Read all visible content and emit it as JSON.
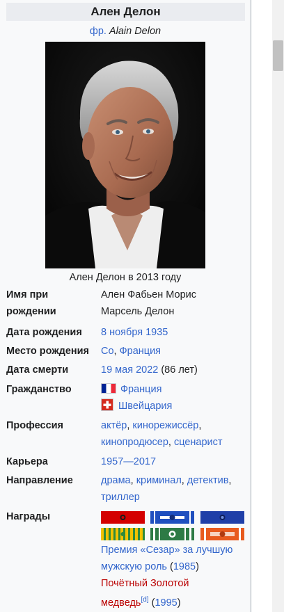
{
  "infobox": {
    "title": "Ален Делон",
    "original_lang": "фр.",
    "original_name": "Alain Delon",
    "caption": "Ален Делон в 2013 году",
    "birth_name_label_1": "Имя при",
    "birth_name_label_2": "рождении",
    "birth_name_value_1": "Ален Фабьен Морис",
    "birth_name_value_2": "Марсель Делон",
    "birth_date_label": "Дата рождения",
    "birth_date_value": "8 ноября 1935",
    "birth_place_label": "Место рождения",
    "birth_place_town": "Со",
    "birth_place_sep": ", ",
    "birth_place_country": "Франция",
    "death_date_label": "Дата смерти",
    "death_date_value": "19 мая 2022",
    "death_age": " (86 лет)",
    "citizenship_label": "Гражданство",
    "citizenship_1": "Франция",
    "citizenship_2": "Швейцария",
    "profession_label": "Профессия",
    "profession_line1_a": "актёр",
    "profession_sep_1": ", ",
    "profession_line1_b": "кинорежиссёр",
    "profession_sep_2": ",",
    "profession_line2_a": "кинопродюсер",
    "profession_sep_3": ", ",
    "profession_line2_b": "сценарист",
    "career_label": "Карьера",
    "career_value": "1957—2017",
    "genre_label": "Направление",
    "genre_line1_a": "драма",
    "genre_sep_1": ", ",
    "genre_line1_b": "криминал",
    "genre_sep_2": ", ",
    "genre_line1_c": "детектив",
    "genre_sep_3": ",",
    "genre_line2": "триллер",
    "awards_label": "Награды",
    "award1_line1": "Премия «Сезар» за лучшую",
    "award1_line2_link": "мужскую роль",
    "award1_year_open": " (",
    "award1_year": "1985",
    "award1_year_close": ")",
    "award2_line1": "Почётный Золотой",
    "award2_line2": "медведь",
    "award2_sup": "[d]",
    "award2_year_open": " (",
    "award2_year": "1995",
    "award2_year_close": ")"
  },
  "colors": {
    "link": "#3366cc",
    "redlink": "#ba0000",
    "infobox_bg": "#f8f9fa",
    "title_bg": "#eaecf0"
  }
}
